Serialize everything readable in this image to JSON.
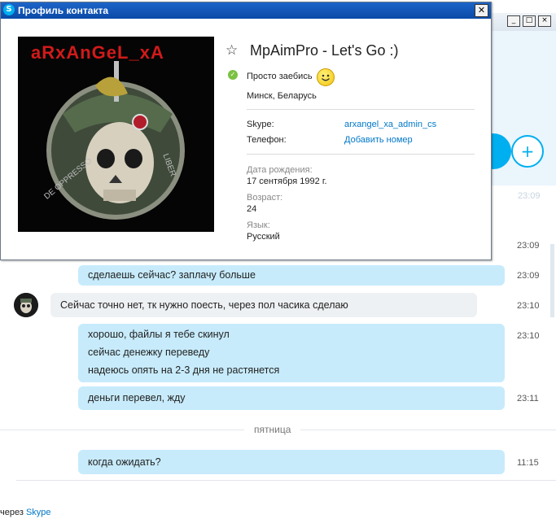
{
  "popup": {
    "title": "Профиль контакта",
    "display_name": "MpAimPro - Let's Go :)",
    "mood": "Просто заебись",
    "location": "Минск, Беларусь",
    "skype_label": "Skype:",
    "skype_value": "arxangel_xa_admin_cs",
    "phone_label": "Телефон:",
    "phone_value": "Добавить номер",
    "birthday_label": "Дата рождения:",
    "birthday_value": "17 сентября 1992 г.",
    "age_label": "Возраст:",
    "age_value": "24",
    "language_label": "Язык:",
    "language_value": "Русский",
    "avatar_text": "aRxAnGeL_xA"
  },
  "chat": {
    "ghost_time": "23:09",
    "messages": [
      {
        "time": "23:09",
        "lines": []
      },
      {
        "time": "23:09",
        "lines": [
          "сделаешь сейчас? заплачу больше"
        ]
      },
      {
        "time": "23:10",
        "lines": [
          "Сейчас точно нет, тк нужно поесть, через пол часика сделаю"
        ]
      },
      {
        "time": "23:10",
        "lines": [
          "хорошо, файлы я тебе скинул",
          "сейчас денежку переведу",
          "надеюсь опять на 2-3 дня не растянется"
        ]
      },
      {
        "time": "23:11",
        "lines": [
          "деньги перевел, жду"
        ]
      },
      {
        "time": "11:15",
        "lines": [
          "когда ожидать?"
        ]
      }
    ],
    "day_divider": "пятница",
    "via_prefix": "через",
    "via_link": "Skype"
  },
  "colors": {
    "outgoing_bubble": "#c7ebfb",
    "incoming_bubble": "#eef1f3",
    "link": "#0078c8",
    "titlebar": "#0b4aa8"
  }
}
